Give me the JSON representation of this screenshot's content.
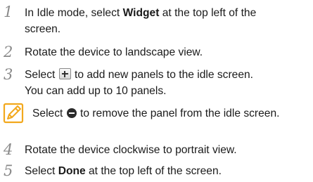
{
  "steps": [
    {
      "num": "1",
      "line1_pre": "In Idle mode, select ",
      "line1_bold": "Widget",
      "line1_post": " at the top left of the",
      "line2": "screen."
    },
    {
      "num": "2",
      "text": "Rotate the device to landscape view."
    },
    {
      "num": "3",
      "line1_pre": "Select ",
      "line1_post": " to add new panels to the idle screen.",
      "line2": "You can add up to 10 panels.",
      "icon": "plus-button-icon"
    },
    {
      "num": "4",
      "text": "Rotate the device clockwise to portrait view."
    },
    {
      "num": "5",
      "pre": "Select ",
      "bold": "Done",
      "post": " at the top left of the screen."
    }
  ],
  "note": {
    "icon": "note-pencil-icon",
    "pre": "Select ",
    "post": " to remove the panel from the idle screen.",
    "inline_icon": "minus-circle-icon",
    "accent_color": "#f2a81d"
  }
}
